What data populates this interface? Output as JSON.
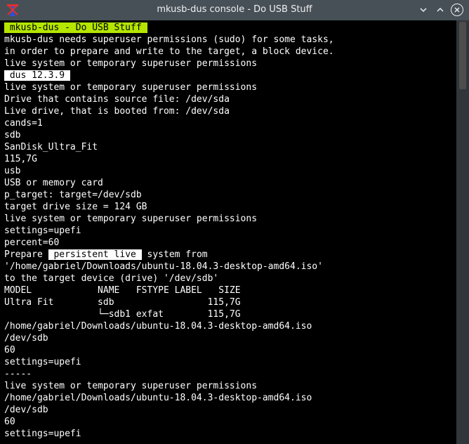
{
  "window": {
    "title": "mkusb-dus console - Do USB Stuff",
    "icons": {
      "app": "mkusb-app-icon",
      "minimize": "chevron-down-icon",
      "maximize": "chevron-up-icon",
      "close": "close-icon"
    },
    "colors": {
      "titlebar": "#475057",
      "terminal_bg": "#000000",
      "terminal_fg": "#ffffff",
      "highlight_green": "#b4e600",
      "highlight_white": "#ffffff"
    }
  },
  "terminal": {
    "lines": [
      {
        "segments": [
          {
            "text": " mkusb-dus - Do USB Stuff ",
            "style": "green"
          }
        ]
      },
      {
        "segments": [
          {
            "text": "mkusb-dus needs superuser permissions (sudo) for some tasks,"
          }
        ]
      },
      {
        "segments": [
          {
            "text": "in order to prepare and write to the target, a block device."
          }
        ]
      },
      {
        "segments": [
          {
            "text": "live system or temporary superuser permissions"
          }
        ]
      },
      {
        "segments": [
          {
            "text": " dus 12.3.9 ",
            "style": "white"
          }
        ]
      },
      {
        "segments": [
          {
            "text": "live system or temporary superuser permissions"
          }
        ]
      },
      {
        "segments": [
          {
            "text": "Drive that contains source file: /dev/sda"
          }
        ]
      },
      {
        "segments": [
          {
            "text": "Live drive, that is booted from: /dev/sda"
          }
        ]
      },
      {
        "segments": [
          {
            "text": "cands=1"
          }
        ]
      },
      {
        "segments": [
          {
            "text": "sdb"
          }
        ]
      },
      {
        "segments": [
          {
            "text": "SanDisk_Ultra_Fit"
          }
        ]
      },
      {
        "segments": [
          {
            "text": "115,7G"
          }
        ]
      },
      {
        "segments": [
          {
            "text": "usb"
          }
        ]
      },
      {
        "segments": [
          {
            "text": "USB or memory card"
          }
        ]
      },
      {
        "segments": [
          {
            "text": "p_target: target=/dev/sdb"
          }
        ]
      },
      {
        "segments": [
          {
            "text": "target drive size = 124 GB"
          }
        ]
      },
      {
        "segments": [
          {
            "text": "live system or temporary superuser permissions"
          }
        ]
      },
      {
        "segments": [
          {
            "text": "settings=upefi"
          }
        ]
      },
      {
        "segments": [
          {
            "text": "percent=60"
          }
        ]
      },
      {
        "segments": [
          {
            "text": "Prepare "
          },
          {
            "text": " persistent live ",
            "style": "white"
          },
          {
            "text": " system from"
          }
        ]
      },
      {
        "segments": [
          {
            "text": "'/home/gabriel/Downloads/ubuntu-18.04.3-desktop-amd64.iso'"
          }
        ]
      },
      {
        "segments": [
          {
            "text": "to the target device (drive) '/dev/sdb'"
          }
        ]
      },
      {
        "segments": [
          {
            "text": "MODEL            NAME   FSTYPE LABEL   SIZE"
          }
        ]
      },
      {
        "segments": [
          {
            "text": "Ultra Fit        sdb                 115,7G"
          }
        ]
      },
      {
        "segments": [
          {
            "text": "                 └─sdb1 exfat        115,7G"
          }
        ]
      },
      {
        "segments": [
          {
            "text": "/home/gabriel/Downloads/ubuntu-18.04.3-desktop-amd64.iso"
          }
        ]
      },
      {
        "segments": [
          {
            "text": "/dev/sdb"
          }
        ]
      },
      {
        "segments": [
          {
            "text": "60"
          }
        ]
      },
      {
        "segments": [
          {
            "text": "settings=upefi"
          }
        ]
      },
      {
        "segments": [
          {
            "text": "-----"
          }
        ]
      },
      {
        "segments": [
          {
            "text": "live system or temporary superuser permissions"
          }
        ]
      },
      {
        "segments": [
          {
            "text": "/home/gabriel/Downloads/ubuntu-18.04.3-desktop-amd64.iso"
          }
        ]
      },
      {
        "segments": [
          {
            "text": "/dev/sdb"
          }
        ]
      },
      {
        "segments": [
          {
            "text": "60"
          }
        ]
      },
      {
        "segments": [
          {
            "text": "settings=upefi"
          }
        ]
      }
    ]
  }
}
